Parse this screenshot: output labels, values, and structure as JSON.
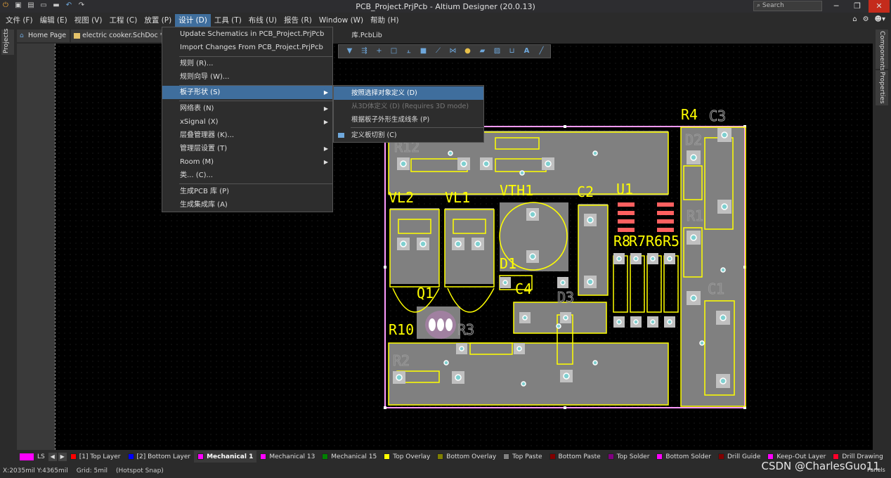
{
  "window": {
    "title": "PCB_Project.PrjPcb - Altium Designer (20.0.13)",
    "search_placeholder": "Search"
  },
  "menubar": [
    "文件 (F)",
    "编辑 (E)",
    "视图 (V)",
    "工程 (C)",
    "放置 (P)",
    "设计 (D)",
    "工具 (T)",
    "布线 (U)",
    "报告 (R)",
    "Window (W)",
    "帮助 (H)"
  ],
  "tabs": [
    {
      "label": "Home Page"
    },
    {
      "label": "electric cooker.SchDoc *"
    },
    {
      "label": "e"
    },
    {
      "label": "库.PcbLib"
    }
  ],
  "left_panel": "Projects",
  "right_panels": [
    "Components",
    "Properties"
  ],
  "design_menu": {
    "items": [
      {
        "label": "Update Schematics in PCB_Project.PrjPcb"
      },
      {
        "label": "Import Changes From PCB_Project.PrjPcb"
      },
      {
        "label": "规则 (R)..."
      },
      {
        "label": "规则向导 (W)..."
      },
      {
        "label": "板子形状 (S)"
      },
      {
        "label": "网络表 (N)"
      },
      {
        "label": "xSignal (X)"
      },
      {
        "label": "层叠管理器 (K)..."
      },
      {
        "label": "管理层设置 (T)"
      },
      {
        "label": "Room (M)"
      },
      {
        "label": "类... (C)..."
      },
      {
        "label": "生成PCB 库 (P)"
      },
      {
        "label": "生成集成库 (A)"
      }
    ]
  },
  "board_shape_menu": {
    "items": [
      {
        "label": "按照选择对象定义 (D)"
      },
      {
        "label": "从3D体定义 (D) (Requires 3D mode)"
      },
      {
        "label": "根据板子外形生成线条 (P)"
      },
      {
        "label": "定义板切割 (C)"
      }
    ]
  },
  "pcb": {
    "designators": [
      "R4",
      "C3",
      "VL2",
      "VL1",
      "VTH1",
      "C2",
      "U1",
      "R8",
      "R7",
      "R6",
      "R5",
      "D1",
      "C4",
      "Q1",
      "R10",
      "R3",
      "D3",
      "C1",
      "R1",
      "R2",
      "R12",
      "D2"
    ],
    "colors": {
      "overlay": "#ffff00",
      "board": "#808080",
      "outline": "#ff9aff",
      "pad": "#c0c0c0",
      "via": "#7fd0d0"
    }
  },
  "layers": [
    {
      "label": "[1] Top Layer",
      "color": "#ff0000"
    },
    {
      "label": "[2] Bottom Layer",
      "color": "#0000ff"
    },
    {
      "label": "Mechanical 1",
      "color": "#ff00ff",
      "active": true
    },
    {
      "label": "Mechanical 13",
      "color": "#ff00ff"
    },
    {
      "label": "Mechanical 15",
      "color": "#008000"
    },
    {
      "label": "Top Overlay",
      "color": "#ffff00"
    },
    {
      "label": "Bottom Overlay",
      "color": "#808000"
    },
    {
      "label": "Top Paste",
      "color": "#808080"
    },
    {
      "label": "Bottom Paste",
      "color": "#800000"
    },
    {
      "label": "Top Solder",
      "color": "#800080"
    },
    {
      "label": "Bottom Solder",
      "color": "#ff00ff"
    },
    {
      "label": "Drill Guide",
      "color": "#800000"
    },
    {
      "label": "Keep-Out Layer",
      "color": "#ff00ff"
    },
    {
      "label": "Drill Drawing",
      "color": "#ff002a"
    }
  ],
  "ls_label": "LS",
  "status": {
    "coords": "X:2035mil Y:4365mil",
    "grid": "Grid: 5mil",
    "snap": "(Hotspot Snap)"
  },
  "panels_label": "Panels",
  "watermark": "CSDN @CharlesGuo11"
}
